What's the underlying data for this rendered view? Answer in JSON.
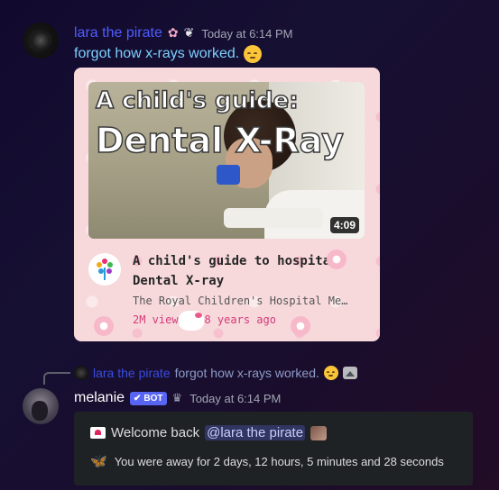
{
  "message1": {
    "username": "lara the pirate",
    "badge_emojis": [
      "✿",
      "❦"
    ],
    "timestamp": "Today at 6:14 PM",
    "content": "forgot how x-rays worked."
  },
  "video_embed": {
    "thumbnail_text_small": "A child's guide:",
    "thumbnail_text_big": "Dental X-Ray",
    "duration": "4:09",
    "title": "A child's guide to hospital: Dental X-ray",
    "channel": "The Royal Children's Hospital Mel...",
    "meta": "2M views • 8 years ago"
  },
  "reply": {
    "username": "lara the pirate",
    "text": "forgot how x-rays worked."
  },
  "message2": {
    "username": "melanie",
    "bot_tag": "BOT",
    "bot_check": "✔",
    "crown": "♛",
    "timestamp": "Today at 6:14 PM",
    "embed": {
      "welcome_prefix": "Welcome back",
      "mention": "@lara the pirate",
      "away_text": "You were away for 2 days, 12 hours, 5 minutes and 28 seconds",
      "butterfly": "🦋"
    }
  }
}
